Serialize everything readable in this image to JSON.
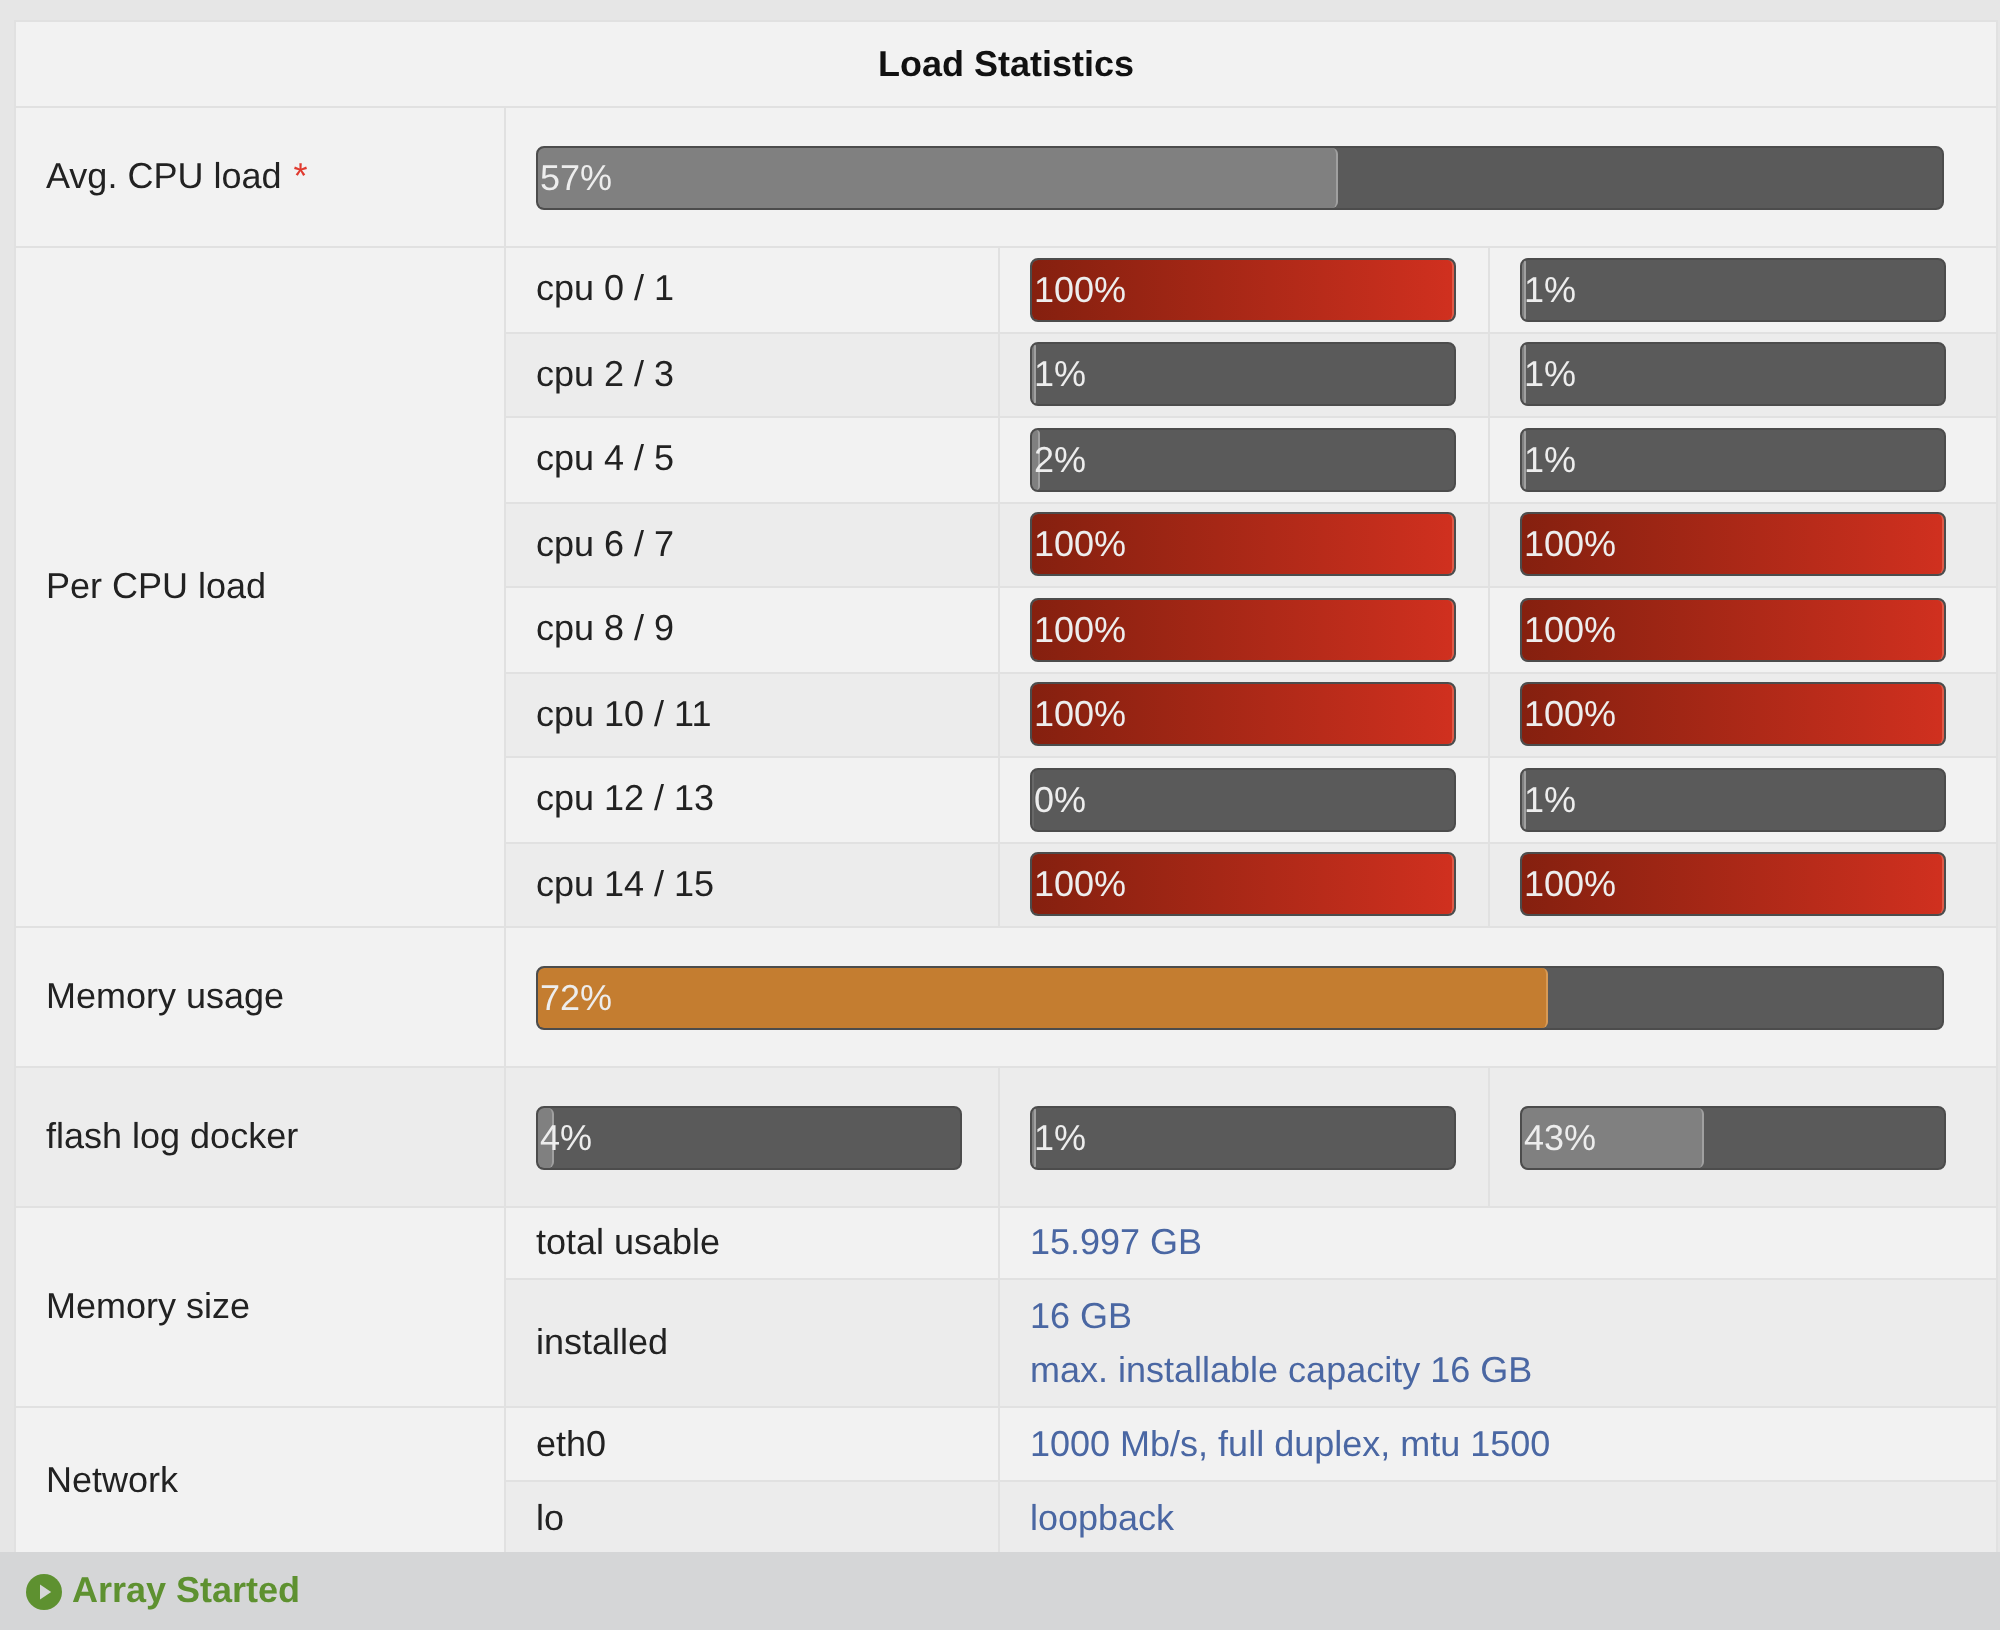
{
  "title": "Load Statistics",
  "rows": [
    {
      "kind": "bar",
      "label": "Avg. CPU load",
      "marker": "*",
      "bars": [
        {
          "level": 0.57,
          "reading": "57%"
        }
      ]
    },
    {
      "kind": "cpu_grid",
      "label": "Per CPU load",
      "cpus": [
        {
          "name": "cpu 0 / 1",
          "bars": [
            {
              "level": 1,
              "reading": "100%"
            },
            {
              "level": 0.01,
              "reading": "1%"
            }
          ]
        },
        {
          "name": "cpu 2 / 3",
          "bars": [
            {
              "level": 0.01,
              "reading": "1%"
            },
            {
              "level": 0.01,
              "reading": "1%"
            }
          ]
        },
        {
          "name": "cpu 4 / 5",
          "bars": [
            {
              "level": 0.02,
              "reading": "2%"
            },
            {
              "level": 0.01,
              "reading": "1%"
            }
          ]
        },
        {
          "name": "cpu 6 / 7",
          "bars": [
            {
              "level": 1,
              "reading": "100%"
            },
            {
              "level": 1,
              "reading": "100%"
            }
          ]
        },
        {
          "name": "cpu 8 / 9",
          "bars": [
            {
              "level": 1,
              "reading": "100%"
            },
            {
              "level": 1,
              "reading": "100%"
            }
          ]
        },
        {
          "name": "cpu 10 / 11",
          "bars": [
            {
              "level": 1,
              "reading": "100%"
            },
            {
              "level": 1,
              "reading": "100%"
            }
          ]
        },
        {
          "name": "cpu 12 / 13",
          "bars": [
            {
              "level": 0,
              "reading": "0%"
            },
            {
              "level": 0.01,
              "reading": "1%"
            }
          ]
        },
        {
          "name": "cpu 14 / 15",
          "bars": [
            {
              "level": 1,
              "reading": "100%"
            },
            {
              "level": 1,
              "reading": "100%"
            }
          ]
        }
      ]
    },
    {
      "kind": "bar",
      "label": "Memory usage",
      "bars": [
        {
          "level": 0.72,
          "reading": "72%"
        }
      ]
    },
    {
      "kind": "bar",
      "label": "flash log docker",
      "bars": [
        {
          "level": 0.04,
          "reading": "4%"
        },
        {
          "level": 0.01,
          "reading": "1%"
        },
        {
          "level": 0.43,
          "reading": "43%"
        }
      ]
    },
    {
      "kind": "info",
      "label": "Memory size",
      "items": [
        {
          "name": "total usable",
          "values": [
            "15.997 GB"
          ]
        },
        {
          "name": "installed",
          "values": [
            "16 GB",
            "max. installable capacity 16 GB"
          ]
        }
      ]
    },
    {
      "kind": "info",
      "label": "Network",
      "items": [
        {
          "name": "eth0",
          "values": [
            "1000 Mb/s, full duplex, mtu 1500"
          ]
        },
        {
          "name": "lo",
          "values": [
            "loopback"
          ]
        }
      ]
    }
  ],
  "status_bar": {
    "text": "Array Started"
  }
}
